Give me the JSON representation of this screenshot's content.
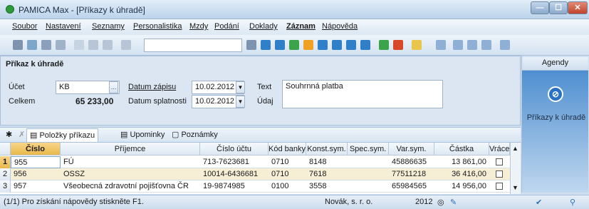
{
  "window": {
    "title": "PAMICA Max - [Příkazy k úhradě]"
  },
  "menu": [
    "Soubor",
    "Nastavení",
    "Seznamy",
    "Personalistika",
    "Mzdy",
    "Podání",
    "Doklady",
    "Záznam",
    "Nápověda"
  ],
  "form": {
    "section_title": "Příkaz k úhradě",
    "ucet_label": "Účet",
    "ucet_value": "KB",
    "celkem_label": "Celkem",
    "celkem_value": "65 233,00",
    "datum_zapisu_label": "Datum zápisu",
    "datum_zapisu_value": "10.02.2012",
    "datum_splatnosti_label": "Datum splatnosti",
    "datum_splatnosti_value": "10.02.2012",
    "text_label": "Text",
    "udaj_label": "Údaj",
    "text_value": "Souhrnná platba"
  },
  "agendy": {
    "header": "Agendy",
    "item_label": "Příkazy k úhradě"
  },
  "tabs": [
    {
      "label": "Položky příkazu"
    },
    {
      "label": "Upominky"
    },
    {
      "label": "Poznámky"
    }
  ],
  "grid": {
    "columns": [
      "Číslo",
      "Příjemce",
      "Číslo účtu",
      "Kód banky",
      "Konst.sym.",
      "Spec.sym.",
      "Var.sym.",
      "Částka",
      "Vráce"
    ],
    "rows": [
      {
        "n": "1",
        "cislo": "955",
        "prijemce": "FÚ",
        "ucet": "713-7623681",
        "kod": "0710",
        "konst": "8148",
        "spec": "",
        "var": "45886635",
        "castka": "13 861,00"
      },
      {
        "n": "2",
        "cislo": "956",
        "prijemce": "OSSZ",
        "ucet": "10014-6436681",
        "kod": "0710",
        "konst": "7618",
        "spec": "",
        "var": "77511218",
        "castka": "36 416,00"
      },
      {
        "n": "3",
        "cislo": "957",
        "prijemce": "Všeobecná zdravotní pojišťovna ČR",
        "ucet": "19-9874985",
        "kod": "0100",
        "konst": "3558",
        "spec": "",
        "var": "65984565",
        "castka": "14 956,00"
      }
    ]
  },
  "status": {
    "hint": "(1/1) Pro získání nápovědy stiskněte F1.",
    "company": "Novák, s. r. o.",
    "year": "2012"
  }
}
